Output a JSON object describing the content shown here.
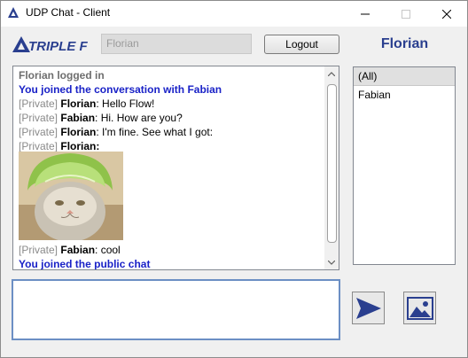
{
  "window": {
    "title": "UDP Chat - Client"
  },
  "header": {
    "logo_text": "TRIPLE F",
    "username_value": "Florian",
    "logout_label": "Logout",
    "current_user": "Florian"
  },
  "chat": {
    "lines": [
      {
        "prefix": "",
        "sender": "",
        "text": "Florian logged in",
        "style": "system-grey"
      },
      {
        "prefix": "",
        "sender": "",
        "text": "You joined the conversation with Fabian",
        "style": "system-blue"
      },
      {
        "prefix": "[Private]",
        "sender": "Florian",
        "text": ": Hello Flow!",
        "style": "message"
      },
      {
        "prefix": "[Private]",
        "sender": "Fabian",
        "text": ": Hi. How are you?",
        "style": "message"
      },
      {
        "prefix": "[Private]",
        "sender": "Florian",
        "text": ": I'm fine. See what I got:",
        "style": "message"
      },
      {
        "prefix": "[Private]",
        "sender": "Florian:",
        "text": "",
        "style": "message"
      }
    ],
    "lines_after_image": [
      {
        "prefix": "[Private]",
        "sender": "Fabian",
        "text": ": cool",
        "style": "message"
      },
      {
        "prefix": "",
        "sender": "",
        "text": "You joined the public chat",
        "style": "system-blue"
      }
    ]
  },
  "users": {
    "items": [
      {
        "label": "(All)",
        "selected": true
      },
      {
        "label": "Fabian",
        "selected": false
      }
    ]
  },
  "message_input": {
    "value": ""
  },
  "icons": {
    "app": "triple-f-app-icon",
    "send": "send-arrow-icon",
    "image": "image-picture-icon"
  },
  "colors": {
    "accent": "#2a3f8f",
    "system_blue": "#1a22c7",
    "input_border": "#6c8fc4"
  }
}
